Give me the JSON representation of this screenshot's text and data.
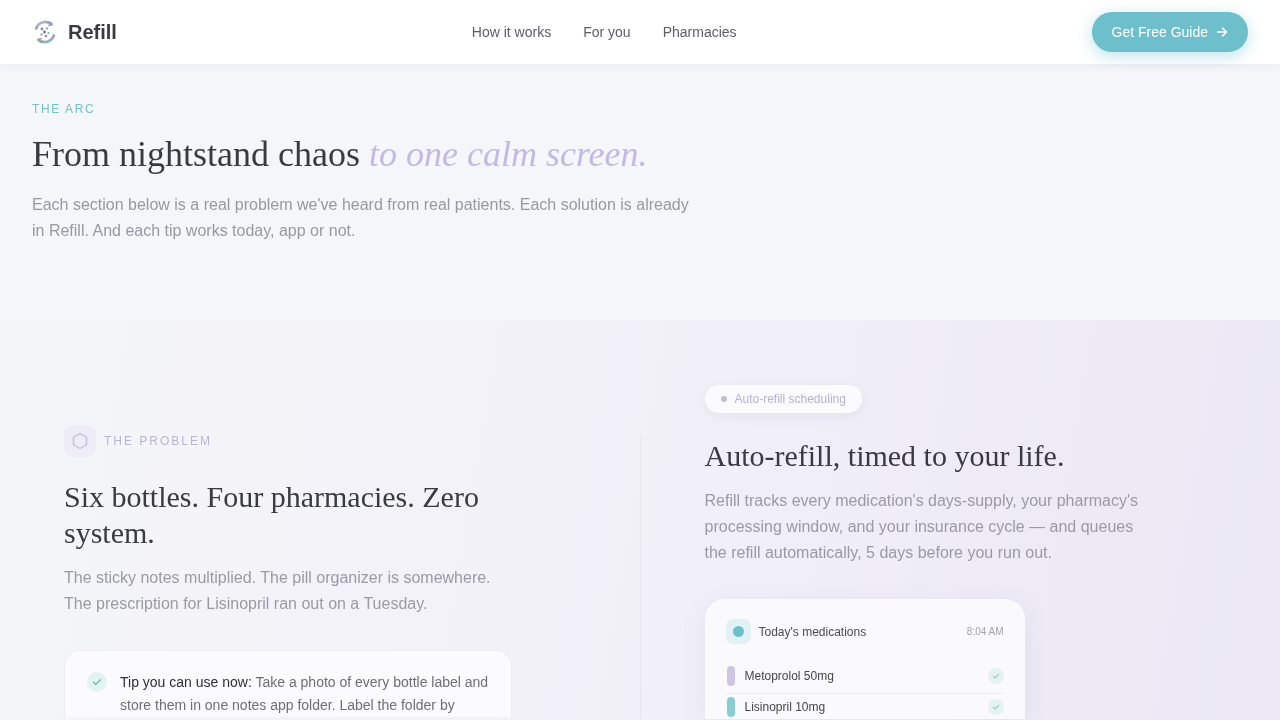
{
  "header": {
    "brand": "Refill",
    "nav": [
      {
        "label": "How it works"
      },
      {
        "label": "For you"
      },
      {
        "label": "Pharmacies"
      }
    ],
    "cta": {
      "label": "Get Free Guide"
    }
  },
  "intro": {
    "eyebrow": "THE ARC",
    "title": "From nightstand chaos",
    "title_accent": "to one calm screen.",
    "text": "Each section below is a real problem we've heard from real patients. Each solution is already in Refill. And each tip works today, app or not."
  },
  "problem": {
    "eyebrow": "THE PROBLEM",
    "title": "Six bottles. Four pharmacies. Zero system.",
    "text": "The sticky notes multiplied. The pill organizer is somewhere. The prescription for Lisinopril ran out on a Tuesday.",
    "tip": "**Tip you can use now:** Take a photo of every bottle label and store them in one notes app folder. Label the folder by"
  },
  "solution": {
    "chip": "Auto-refill scheduling",
    "title": "Auto-refill, timed to your life.",
    "text": "Refill tracks every medication's days-supply, your pharmacy's processing window, and your insurance cycle — and queues the refill automatically, 5 days before you run out.",
    "card": {
      "title": "Today's medications",
      "time": "8:04 AM",
      "items": [
        {
          "name": "Metoprolol 50mg",
          "color": "#cdc5e6",
          "checked": true
        },
        {
          "name": "Lisinopril 10mg",
          "color": "#86cdd6",
          "checked": true
        }
      ]
    }
  }
}
